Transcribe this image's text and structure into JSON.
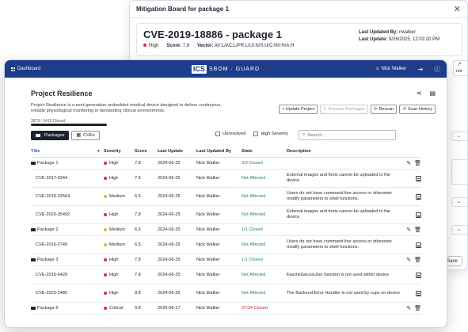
{
  "modal": {
    "title": "Mitigation Board for package 1",
    "close": "✕",
    "cve_id": "CVE-2019-18886 - package 1",
    "severity": "High",
    "score_label": "Score:",
    "score": "7.8",
    "vector_label": "Vector:",
    "vector": "AV:L/AC:L/PR:L/UI:N/S:U/C:H/I:H/A:H",
    "updated_by_label": "Last Updated By:",
    "updated_by": "nwalker",
    "update_label": "Last Update:",
    "update": "9/26/2025, 12:02:20 PM",
    "side_fragment": "not",
    "save_label": "Save"
  },
  "topbar": {
    "dashboard_label": "Dashboard",
    "brand_logo": "ICS",
    "brand_name": "SBOM · GUARD",
    "user": "Nick Walker"
  },
  "project": {
    "title": "Project Resilience",
    "description": "Project Resilience is a next-generation embedded medical device designed to deliver continuous, reliable physiological monitoring in demanding clinical environments.",
    "counts": "3879 / 3415 Closed",
    "progress": 0.88
  },
  "actions": {
    "update": "+ Update Project",
    "recover": "Recover Packages",
    "rescan": "Rescan",
    "history": "Scan History"
  },
  "tabs": {
    "packages": "Packages",
    "cves": "CVEs"
  },
  "filters": {
    "unresolved": "Unresolved",
    "high_severity": "High Severity",
    "search_placeholder": "Search..."
  },
  "table": {
    "headers": {
      "title": "Title",
      "severity": "Severity",
      "score": "Score",
      "last_update": "Last Update",
      "last_updated_by": "Last Updated By",
      "state": "State",
      "description": "Description"
    },
    "rows": [
      {
        "type": "package",
        "title": "Package 1",
        "severity": "High",
        "sev_color": "#d62f3a",
        "score": "7.8",
        "last_update": "2024-06-25",
        "by": "Nick Walker",
        "state": "3/3 Closed",
        "state_color": "green",
        "description": ""
      },
      {
        "type": "cve",
        "title": "CVE-2017-9344",
        "severity": "High",
        "sev_color": "#d62f3a",
        "score": "7.5",
        "last_update": "2024-06-25",
        "by": "Nick Walker",
        "state": "Not Affected",
        "state_color": "green",
        "description": "External images and fonts cannot be uploaded to the device."
      },
      {
        "type": "cve",
        "title": "CVE-2018-32564",
        "severity": "Medium",
        "sev_color": "#e6b62a",
        "score": "6.5",
        "last_update": "2024-06-25",
        "by": "Nick Walker",
        "state": "Not Affected",
        "state_color": "green",
        "description": "Users do not have command line access or otherwise modify parameters to shell functions."
      },
      {
        "type": "cve",
        "title": "CVE-2020-35492",
        "severity": "High",
        "sev_color": "#d62f3a",
        "score": "7.8",
        "last_update": "2024-06-25",
        "by": "Nick Walker",
        "state": "Not Affected",
        "state_color": "green",
        "description": "External images and fonts cannot be uploaded to the device."
      },
      {
        "type": "package",
        "title": "Package 2",
        "severity": "Medium",
        "sev_color": "#e6b62a",
        "score": "6.5",
        "last_update": "2024-06-25",
        "by": "Nick Walker",
        "state": "1/1 Closed",
        "state_color": "green",
        "description": ""
      },
      {
        "type": "cve",
        "title": "CVE-2016-2749",
        "severity": "Medium",
        "sev_color": "#e6b62a",
        "score": "6.5",
        "last_update": "2024-06-25",
        "by": "Nick Walker",
        "state": "Not Affected",
        "state_color": "green",
        "description": "Users do not have command line access or otherwise modify parameters to shell functions."
      },
      {
        "type": "package",
        "title": "Package 3",
        "severity": "High",
        "sev_color": "#d62f3a",
        "score": "7.8",
        "last_update": "2024-06-25",
        "by": "Nick Walker",
        "state": "1/1 Closed",
        "state_color": "green",
        "description": ""
      },
      {
        "type": "cve",
        "title": "CVE-2016-6428",
        "severity": "High",
        "sev_color": "#d62f3a",
        "score": "7.8",
        "last_update": "2024-06-25",
        "by": "Nick Walker",
        "state": "Not Affected",
        "state_color": "green",
        "description": "FascistGecosUser function is not used within device"
      },
      {
        "type": "cve",
        "title": "CVE-2023-2485",
        "severity": "High",
        "sev_color": "#d62f3a",
        "score": "8.8",
        "last_update": "2024-06-25",
        "by": "Nick Walker",
        "state": "Not Affected",
        "state_color": "green",
        "description": "The Backend Error Handler is not used by cups on device"
      },
      {
        "type": "package",
        "title": "Package 6",
        "severity": "Critical",
        "sev_color": "#d62f3a",
        "score": "9.8",
        "last_update": "2025-08-17",
        "by": "Nick Walker",
        "state": "37/34 Closed",
        "state_color": "red",
        "description": ""
      }
    ]
  },
  "colors": {
    "topbar": "#1c3d8a",
    "link_blue": "#2a62c9",
    "closed_green": "#1f8a4c",
    "open_red": "#c92b36",
    "high": "#d62f3a",
    "medium": "#e6b62a"
  }
}
